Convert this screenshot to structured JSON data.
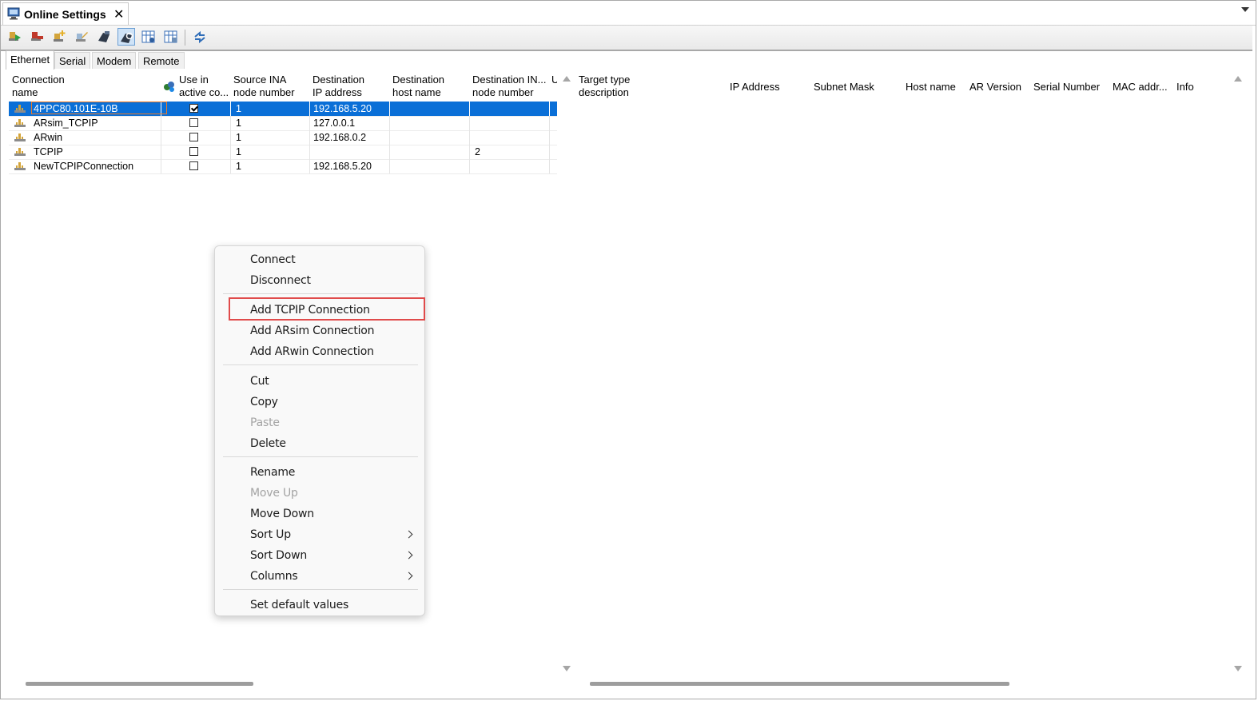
{
  "window": {
    "tab_title": "Online Settings",
    "close_glyph": "✕"
  },
  "toolbar": {
    "buttons": [
      "connect-icon",
      "disconnect-icon",
      "add-connection-icon",
      "edit-connection-icon",
      "target-browse-icon",
      "target-search-icon",
      "grid-view-icon",
      "grid-properties-icon",
      "refresh-icon"
    ]
  },
  "tabs": [
    "Ethernet",
    "Serial",
    "Modem",
    "Remote"
  ],
  "active_tab": "Ethernet",
  "connections": {
    "headers": {
      "name": "Connection\nname",
      "use_active": "Use in\nactive co...",
      "source_ina": "Source INA\nnode number",
      "dest_ip": "Destination\nIP address",
      "dest_host": "Destination\nhost name",
      "dest_ina": "Destination IN...\nnode number",
      "extra": "U"
    },
    "rows": [
      {
        "name": "4PPC80.101E-10B",
        "active": true,
        "source_ina": "1",
        "dest_ip": "192.168.5.20",
        "dest_host": "",
        "dest_ina": "",
        "selected": true
      },
      {
        "name": "ARsim_TCPIP",
        "active": false,
        "source_ina": "1",
        "dest_ip": "127.0.0.1",
        "dest_host": "",
        "dest_ina": "",
        "selected": false
      },
      {
        "name": "ARwin",
        "active": false,
        "source_ina": "1",
        "dest_ip": "192.168.0.2",
        "dest_host": "",
        "dest_ina": "",
        "selected": false
      },
      {
        "name": "TCPIP",
        "active": false,
        "source_ina": "1",
        "dest_ip": "",
        "dest_host": "",
        "dest_ina": "2",
        "selected": false
      },
      {
        "name": "NewTCPIPConnection",
        "active": false,
        "source_ina": "1",
        "dest_ip": "192.168.5.20",
        "dest_host": "",
        "dest_ina": "",
        "selected": false
      }
    ]
  },
  "targets": {
    "headers": {
      "type": "Target type\ndescription",
      "ip": "IP Address",
      "mask": "Subnet Mask",
      "host": "Host name",
      "ar": "AR Version",
      "serial": "Serial Number",
      "mac": "MAC addr...",
      "info": "Info"
    }
  },
  "context_menu": {
    "connect": "Connect",
    "disconnect": "Disconnect",
    "add_tcpip": "Add TCPIP Connection",
    "add_arsim": "Add ARsim Connection",
    "add_arwin": "Add ARwin Connection",
    "cut": "Cut",
    "copy": "Copy",
    "paste": "Paste",
    "delete": "Delete",
    "rename": "Rename",
    "move_up": "Move Up",
    "move_down": "Move Down",
    "sort_up": "Sort Up",
    "sort_down": "Sort Down",
    "columns": "Columns",
    "set_default": "Set default values"
  },
  "colors": {
    "selection": "#0a6fd7",
    "highlight_box": "#e04b4b"
  }
}
